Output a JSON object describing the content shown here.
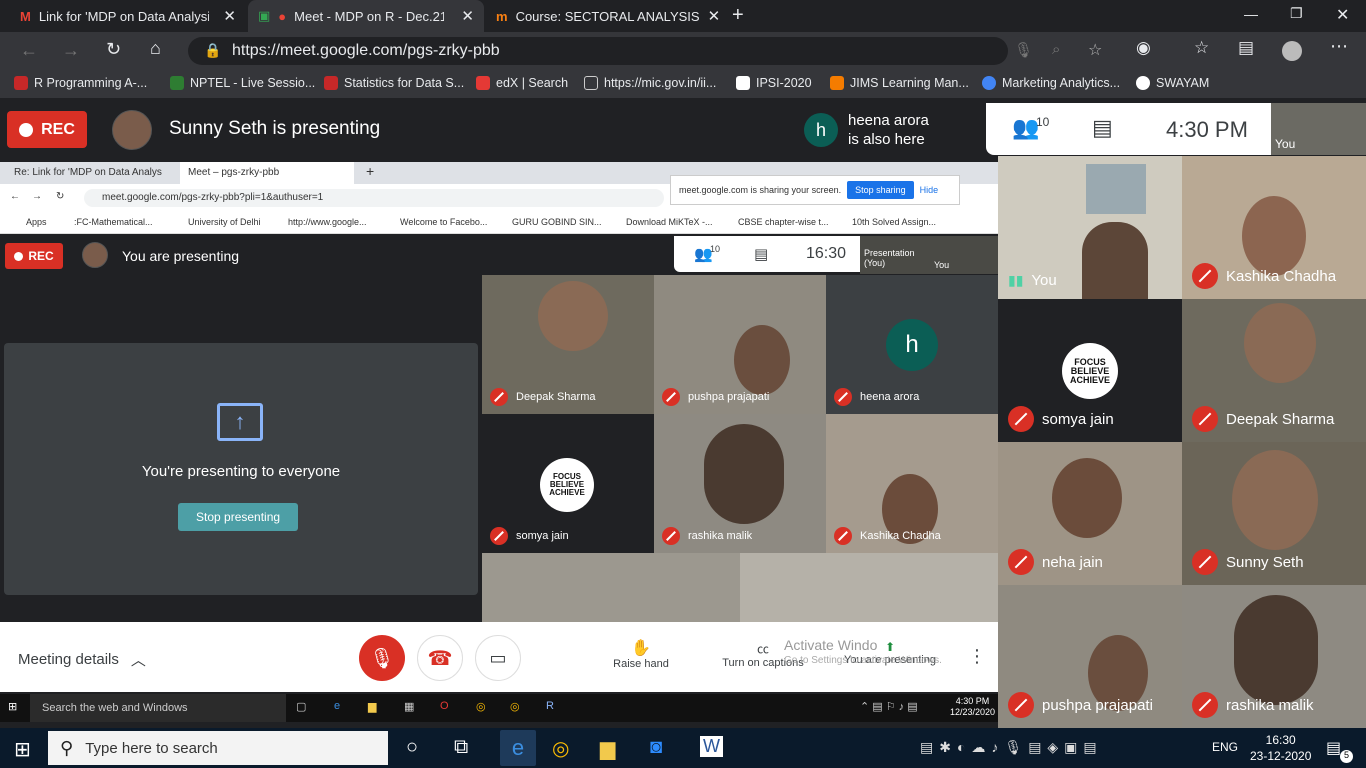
{
  "browser": {
    "tabs": [
      {
        "label": "Link for 'MDP on Data Analysis u"
      },
      {
        "label": "Meet - MDP on R - Dec.21-"
      },
      {
        "label": "Course: SECTORAL ANALYSIS"
      }
    ],
    "url": "https://meet.google.com/pgs-zrky-pbb",
    "bookmarks": [
      "R Programming A-...",
      "NPTEL - Live Sessio...",
      "Statistics for Data S...",
      "edX | Search",
      "https://mic.gov.in/ii...",
      "IPSI-2020",
      "JIMS Learning Man...",
      "Marketing Analytics...",
      "SWAYAM"
    ]
  },
  "meet": {
    "rec_label": "REC",
    "presenter_text": "Sunny Seth is presenting",
    "also_here_name": "heena arora",
    "also_here_suffix": "is also here",
    "also_here_initial": "h",
    "participant_count": "10",
    "time": "4:30 PM",
    "self_label": "You"
  },
  "shared": {
    "tabs": [
      "Re: Link for 'MDP on Data Analys",
      "Meet – pgs-zrky-pbb"
    ],
    "url": "meet.google.com/pgs-zrky-pbb?pli=1&authuser=1",
    "bookmarks": [
      "Apps",
      ":FC-Mathematical...",
      "University of Delhi",
      "http://www.google...",
      "Welcome to Facebo...",
      "GURU GOBIND SIN...",
      "Download MiKTeX -...",
      "CBSE chapter-wise t...",
      "10th Solved Assign..."
    ],
    "sharing_msg": "meet.google.com is sharing your screen.",
    "stop_sharing": "Stop sharing",
    "hide": "Hide",
    "rec_label": "REC",
    "presenting_text": "You are presenting",
    "count": "10",
    "time": "16:30",
    "presentation_label": "Presentation (You)",
    "you_label": "You",
    "presenting_everyone": "You're presenting to everyone",
    "stop_presenting": "Stop presenting",
    "tiles": [
      "Deepak Sharma",
      "pushpa prajapati",
      "heena arora",
      "somya jain",
      "rashika malik",
      "Kashika Chadha"
    ],
    "heena_initial": "h",
    "taskbar_search": "Search the web and Windows",
    "taskbar_time": "4:30 PM",
    "taskbar_date": "12/23/2020"
  },
  "focus_logo": {
    "line1": "FOCUS",
    "line2": "BELIEVE",
    "line3": "ACHIEVE"
  },
  "right_tiles": [
    "You",
    "Kashika Chadha",
    "somya jain",
    "Deepak Sharma",
    "neha jain",
    "Sunny Seth",
    "pushpa prajapati",
    "rashika malik"
  ],
  "controls": {
    "meeting_details": "Meeting details",
    "raise_hand": "Raise hand",
    "captions": "Turn on captions",
    "you_presenting": "You are presenting",
    "activate1": "Activate Windo",
    "activate2": "Go to Settings to activate Windows."
  },
  "taskbar": {
    "search": "Type here to search",
    "lang": "ENG",
    "time": "16:30",
    "date": "23-12-2020",
    "notif": "5"
  }
}
